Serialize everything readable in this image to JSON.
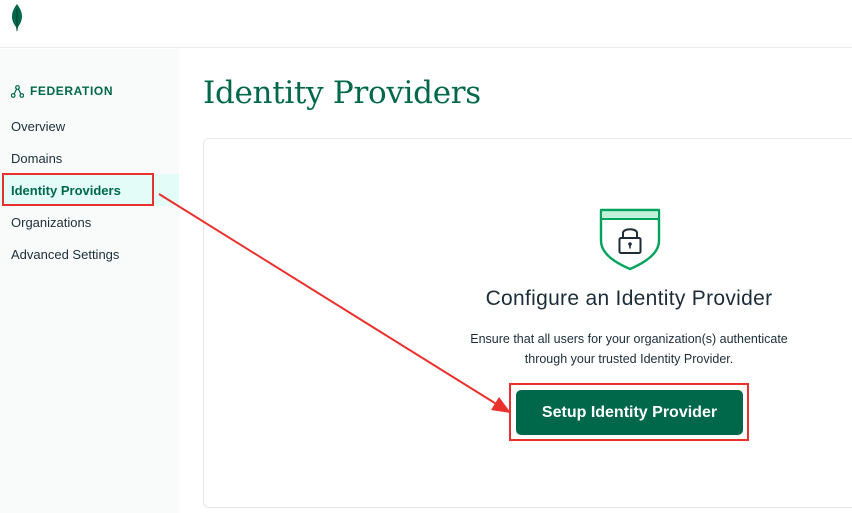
{
  "sidebar": {
    "section": "FEDERATION",
    "items": [
      {
        "label": "Overview"
      },
      {
        "label": "Domains"
      },
      {
        "label": "Identity Providers"
      },
      {
        "label": "Organizations"
      },
      {
        "label": "Advanced Settings"
      }
    ],
    "active_index": 2
  },
  "main": {
    "title": "Identity Providers",
    "card": {
      "heading": "Configure an Identity Provider",
      "desc_line1": "Ensure that all users for your organization(s) authenticate",
      "desc_line2": "through your trusted Identity Provider.",
      "button_label": "Setup Identity Provider",
      "icon": "shield-lock-icon"
    }
  },
  "colors": {
    "brand_green": "#00684a",
    "active_bg": "#e3fcf7",
    "sidebar_bg": "#f9fbfa",
    "annotation_red": "#e8302c"
  }
}
